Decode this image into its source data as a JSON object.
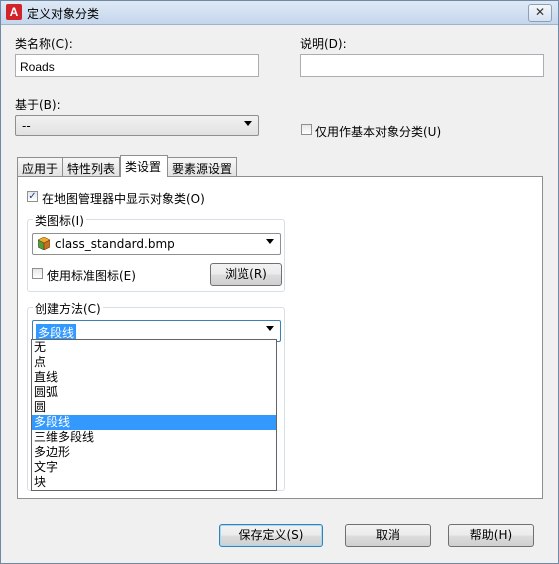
{
  "window": {
    "title": "定义对象分类",
    "close_glyph": "✕",
    "app_icon_letter": "A"
  },
  "form": {
    "class_name_label": "类名称(C):",
    "class_name_value": "Roads",
    "description_label": "说明(D):",
    "description_value": "",
    "base_on_label": "基于(B):",
    "base_on_value": "--",
    "abstract_label": "仅用作基本对象分类(U)",
    "abstract_checked": false
  },
  "tabs": [
    {
      "label": "应用于",
      "active": false
    },
    {
      "label": "特性列表",
      "active": false
    },
    {
      "label": "类设置",
      "active": true
    },
    {
      "label": "要素源设置",
      "active": false
    }
  ],
  "class_settings": {
    "show_in_map_explorer_label": "在地图管理器中显示对象类(O)",
    "show_in_map_explorer_checked": true,
    "icon_group_label": "类图标(I)",
    "icon_value": "class_standard.bmp",
    "use_standard_icon_label": "使用标准图标(E)",
    "use_standard_icon_checked": false,
    "browse_label": "浏览(R)",
    "creation_group_label": "创建方法(C)",
    "creation_method_value": "多段线",
    "creation_method_options": [
      "无",
      "点",
      "直线",
      "圆弧",
      "圆",
      "多段线",
      "三维多段线",
      "多边形",
      "文字",
      "块"
    ],
    "creation_method_selected_index": 5
  },
  "buttons": {
    "save_label": "保存定义(S)",
    "cancel_label": "取消",
    "help_label": "帮助(H)"
  },
  "colors": {
    "selection": "#3399ff",
    "app_icon": "#d2232a"
  }
}
